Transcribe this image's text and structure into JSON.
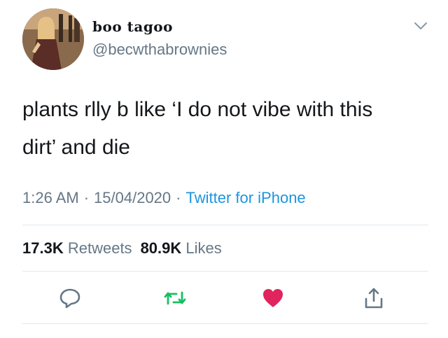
{
  "user": {
    "display_name": "boo tagoo",
    "handle": "@becwthabrownies"
  },
  "tweet": {
    "text_line1": "plants rlly b like ‘I do not vibe with this",
    "text_line2": "dirt’ and die",
    "time": "1:26 AM",
    "date": "15/04/2020",
    "source": "Twitter for iPhone",
    "separator": "·"
  },
  "stats": {
    "retweets_count": "17.3K",
    "retweets_label": "Retweets",
    "likes_count": "80.9K",
    "likes_label": "Likes"
  },
  "icons": {
    "menu": "chevron-down-icon",
    "reply": "reply-icon",
    "retweet": "retweet-icon",
    "like": "heart-icon",
    "share": "share-icon"
  },
  "colors": {
    "text": "#14171a",
    "secondary": "#657786",
    "link": "#1b95e0",
    "retweet_green": "#17bf63",
    "like_red": "#e0245e",
    "divider": "#e1e8ed"
  }
}
